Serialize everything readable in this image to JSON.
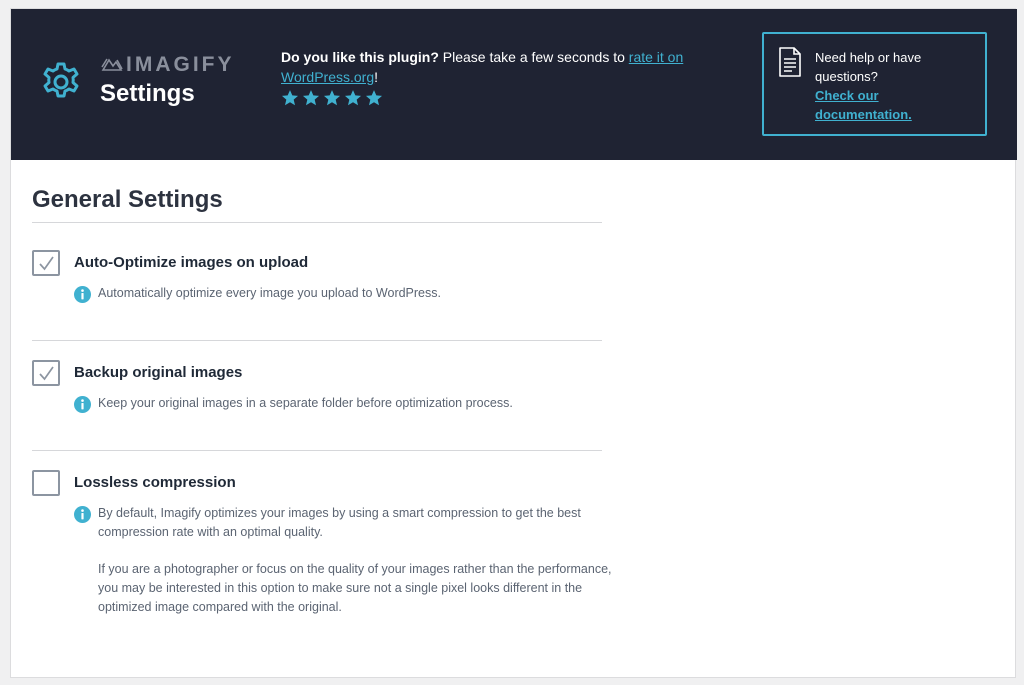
{
  "header": {
    "brand": "IMAGIFY",
    "page_title": "Settings",
    "rating": {
      "question": "Do you like this plugin?",
      "prompt": " Please take a few seconds to ",
      "link_text": "rate it on WordPress.org",
      "suffix": "!",
      "stars": 5
    },
    "help": {
      "text": "Need help or have questions?",
      "link_text": "Check our documentation."
    }
  },
  "main": {
    "section_title": "General Settings",
    "options": [
      {
        "label": "Auto-Optimize images on upload",
        "checked": true,
        "description": [
          "Automatically optimize every image you upload to WordPress."
        ]
      },
      {
        "label": "Backup original images",
        "checked": true,
        "description": [
          "Keep your original images in a separate folder before optimization process."
        ]
      },
      {
        "label": "Lossless compression",
        "checked": false,
        "description": [
          "By default, Imagify optimizes your images by using a smart compression to get the best compression rate with an optimal quality.",
          "If you are a photographer or focus on the quality of your images rather than the performance, you may be interested in this option to make sure not a single pixel looks different in the optimized image compared with the original."
        ]
      }
    ]
  },
  "colors": {
    "header_bg": "#1f2333",
    "accent": "#40b1d0",
    "text_dark": "#1f2937",
    "text_muted": "#5b6472"
  },
  "icons": {
    "settings": "gear-icon",
    "brand": "imagify-logo-icon",
    "rating": "star-icon",
    "help": "document-icon",
    "checked": "checkmark-icon",
    "info": "info-icon"
  }
}
